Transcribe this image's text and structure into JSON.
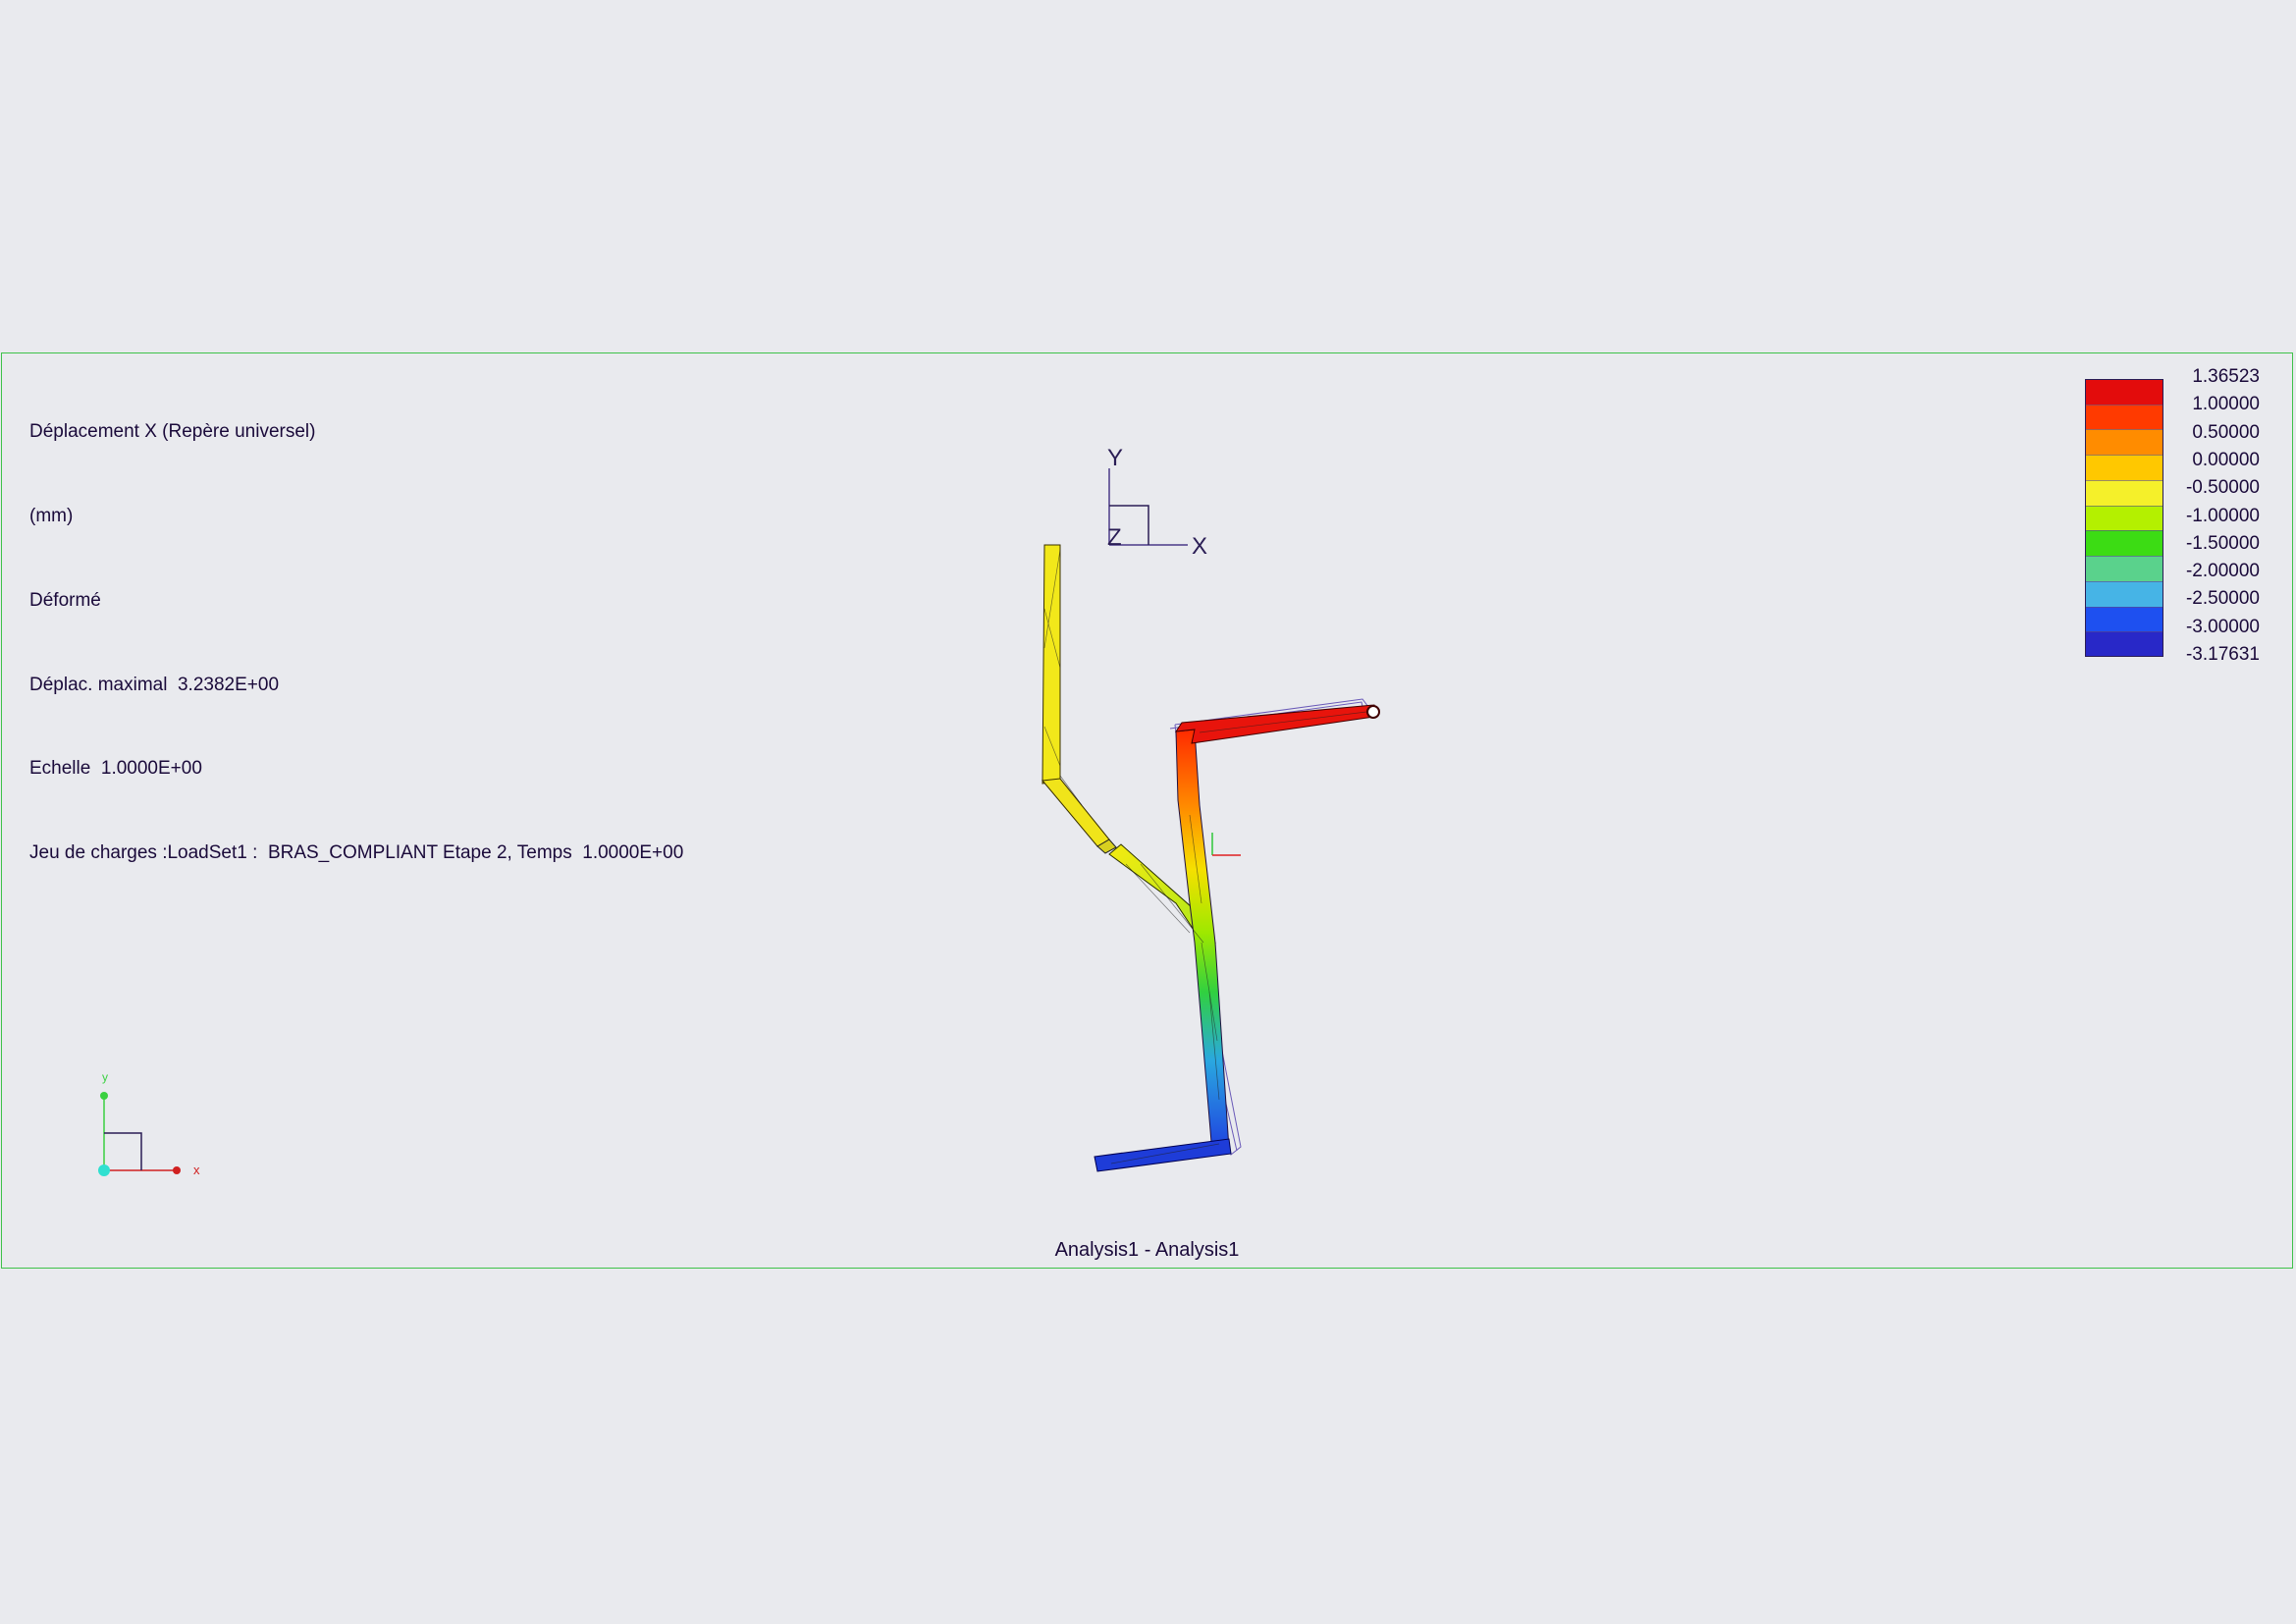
{
  "info": {
    "lines": [
      "Déplacement X (Repère universel)",
      "(mm)",
      "Déformé",
      "Déplac. maximal  3.2382E+00",
      "Echelle  1.0000E+00",
      "Jeu de charges :LoadSet1 :  BRAS_COMPLIANT Etape 2, Temps  1.0000E+00"
    ]
  },
  "legend": {
    "labels": [
      "1.36523",
      "1.00000",
      "0.50000",
      "0.00000",
      "-0.50000",
      "-1.00000",
      "-1.50000",
      "-2.00000",
      "-2.50000",
      "-3.00000",
      "-3.17631"
    ],
    "colors": [
      "#e30c0c",
      "#ff3a00",
      "#ff8c00",
      "#ffc800",
      "#f5f02a",
      "#b4f000",
      "#3cdc14",
      "#5ad28c",
      "#46b4e6",
      "#1e50f0",
      "#2828c8"
    ]
  },
  "triad": {
    "y_label": "Y",
    "x_label": "X",
    "z_label": "Z"
  },
  "mini_axes": {
    "y_label": "y",
    "x_label": "x"
  },
  "footer": {
    "text": "Analysis1 - Analysis1"
  },
  "colors": {
    "background": "#e9eaee",
    "frame": "#3fc24a",
    "text": "#1a0a3a",
    "mesh": "#5a4aa0"
  }
}
